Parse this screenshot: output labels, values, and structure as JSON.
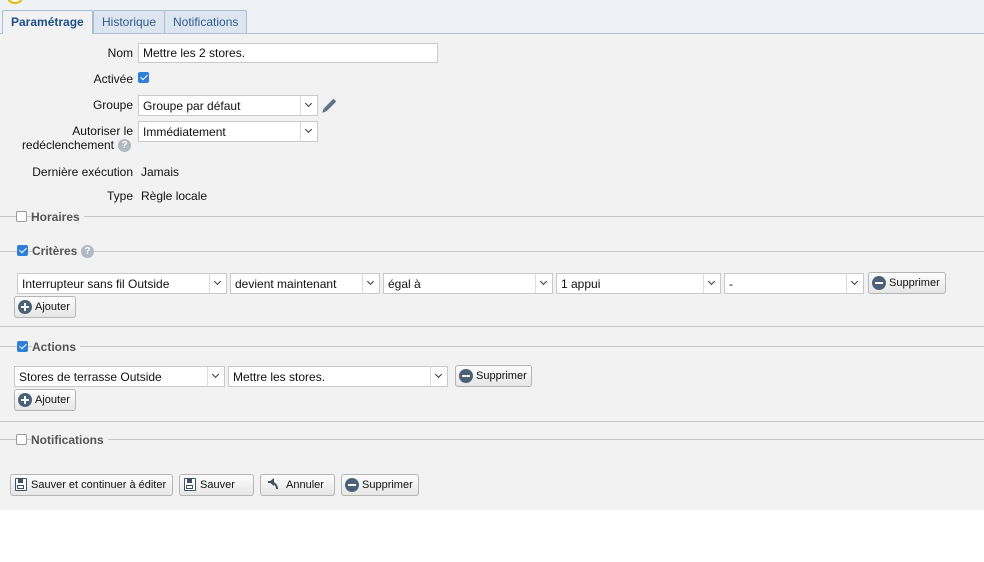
{
  "tabs": [
    "Paramétrage",
    "Historique",
    "Notifications"
  ],
  "form": {
    "nom_label": "Nom",
    "nom_value": "Mettre les 2 stores.",
    "activee_label": "Activée",
    "groupe_label": "Groupe",
    "groupe_value": "Groupe par défaut",
    "autoriser_label_1": "Autoriser le",
    "autoriser_label_2": "redéclenchement",
    "autoriser_value": "Immédiatement",
    "derniere_label": "Dernière exécution",
    "derniere_value": "Jamais",
    "type_label": "Type",
    "type_value": "Règle locale"
  },
  "sections": {
    "horaires": "Horaires",
    "criteres": "Critères",
    "actions": "Actions",
    "notifications": "Notifications"
  },
  "critere_row": {
    "device": "Interrupteur sans fil Outside",
    "condition": "devient maintenant",
    "operator": "égal à",
    "value": "1 appui",
    "extra": "-"
  },
  "action_row": {
    "device": "Stores de terrasse Outside",
    "scene": "Mettre les stores."
  },
  "buttons": {
    "supprimer": "Supprimer",
    "ajouter": "Ajouter",
    "sauver_continuer": "Sauver et continuer à éditer",
    "sauver": "Sauver",
    "annuler": "Annuler",
    "supprimer_rule": "Supprimer"
  },
  "icons": {
    "help": "?"
  }
}
